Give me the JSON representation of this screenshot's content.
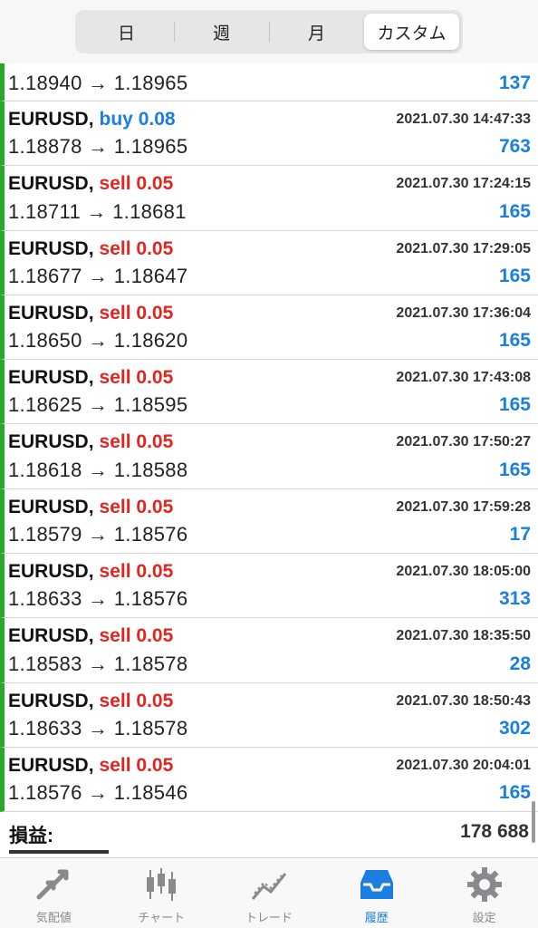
{
  "period_tabs": [
    {
      "label": "日",
      "active": false
    },
    {
      "label": "週",
      "active": false
    },
    {
      "label": "月",
      "active": false
    },
    {
      "label": "カスタム",
      "active": true
    }
  ],
  "trades": [
    {
      "symbol": "",
      "side": "",
      "volume": "",
      "side_text": "",
      "time": "",
      "prices": "1.18940 → 1.18965",
      "profit": "137",
      "partial": true
    },
    {
      "symbol": "EURUSD",
      "side": "buy",
      "side_text": "buy 0.08",
      "time": "2021.07.30 14:47:33",
      "prices": "1.18878 → 1.18965",
      "profit": "763"
    },
    {
      "symbol": "EURUSD",
      "side": "sell",
      "side_text": "sell 0.05",
      "time": "2021.07.30 17:24:15",
      "prices": "1.18711 → 1.18681",
      "profit": "165"
    },
    {
      "symbol": "EURUSD",
      "side": "sell",
      "side_text": "sell 0.05",
      "time": "2021.07.30 17:29:05",
      "prices": "1.18677 → 1.18647",
      "profit": "165"
    },
    {
      "symbol": "EURUSD",
      "side": "sell",
      "side_text": "sell 0.05",
      "time": "2021.07.30 17:36:04",
      "prices": "1.18650 → 1.18620",
      "profit": "165"
    },
    {
      "symbol": "EURUSD",
      "side": "sell",
      "side_text": "sell 0.05",
      "time": "2021.07.30 17:43:08",
      "prices": "1.18625 → 1.18595",
      "profit": "165"
    },
    {
      "symbol": "EURUSD",
      "side": "sell",
      "side_text": "sell 0.05",
      "time": "2021.07.30 17:50:27",
      "prices": "1.18618 → 1.18588",
      "profit": "165"
    },
    {
      "symbol": "EURUSD",
      "side": "sell",
      "side_text": "sell 0.05",
      "time": "2021.07.30 17:59:28",
      "prices": "1.18579 → 1.18576",
      "profit": "17"
    },
    {
      "symbol": "EURUSD",
      "side": "sell",
      "side_text": "sell 0.05",
      "time": "2021.07.30 18:05:00",
      "prices": "1.18633 → 1.18576",
      "profit": "313"
    },
    {
      "symbol": "EURUSD",
      "side": "sell",
      "side_text": "sell 0.05",
      "time": "2021.07.30 18:35:50",
      "prices": "1.18583 → 1.18578",
      "profit": "28"
    },
    {
      "symbol": "EURUSD",
      "side": "sell",
      "side_text": "sell 0.05",
      "time": "2021.07.30 18:50:43",
      "prices": "1.18633 → 1.18578",
      "profit": "302"
    },
    {
      "symbol": "EURUSD",
      "side": "sell",
      "side_text": "sell 0.05",
      "time": "2021.07.30 20:04:01",
      "prices": "1.18576 → 1.18546",
      "profit": "165"
    }
  ],
  "summary": {
    "label": "損益:",
    "value": "178 688"
  },
  "tabbar": [
    {
      "label": "気配値",
      "icon": "quotes-arrows-icon",
      "active": false
    },
    {
      "label": "チャート",
      "icon": "candlestick-chart-icon",
      "active": false
    },
    {
      "label": "トレード",
      "icon": "trade-line-icon",
      "active": false
    },
    {
      "label": "履歴",
      "icon": "history-tray-icon",
      "active": true
    },
    {
      "label": "設定",
      "icon": "gear-icon",
      "active": false
    }
  ],
  "colors": {
    "accent": "#1a7fe0",
    "sell": "#e0261e",
    "indicator": "#28a828",
    "inactive_icon": "#8a8a8e"
  }
}
